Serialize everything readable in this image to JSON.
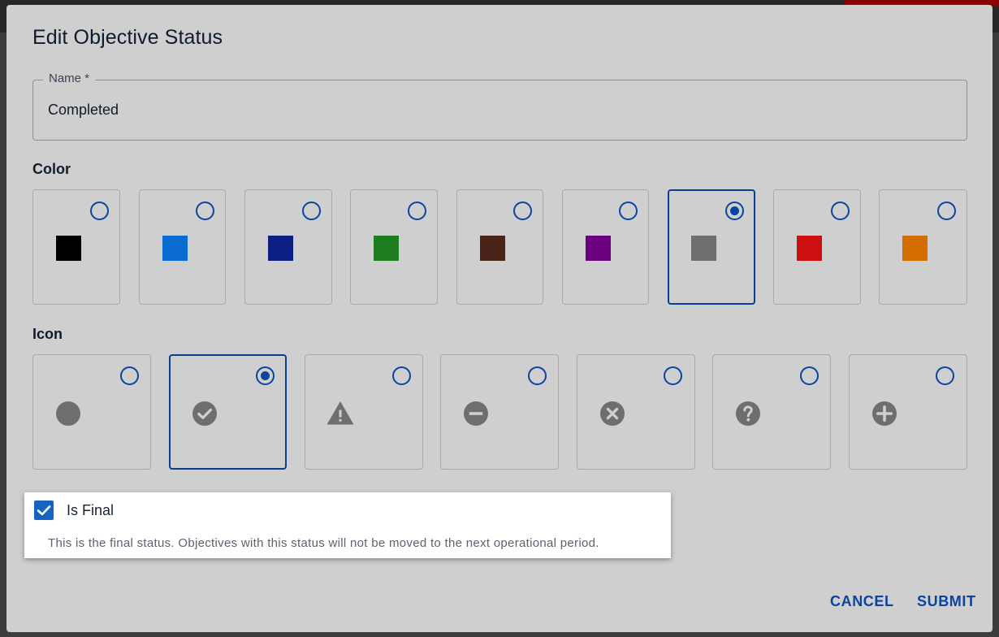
{
  "dialog": {
    "title": "Edit Objective Status"
  },
  "name_field": {
    "label": "Name *",
    "value": "Completed"
  },
  "color_section": {
    "label": "Color",
    "options": [
      {
        "color": "#000000",
        "selected": false
      },
      {
        "color": "#0a6bd1",
        "selected": false
      },
      {
        "color": "#0d1f85",
        "selected": false
      },
      {
        "color": "#1e7d1e",
        "selected": false
      },
      {
        "color": "#4a2418",
        "selected": false
      },
      {
        "color": "#6b0080",
        "selected": false
      },
      {
        "color": "#6e6e6e",
        "selected": true
      },
      {
        "color": "#cc0f0f",
        "selected": false
      },
      {
        "color": "#d46d00",
        "selected": false
      }
    ]
  },
  "icon_section": {
    "label": "Icon",
    "options": [
      {
        "icon": "circle-icon",
        "selected": false
      },
      {
        "icon": "check-circle-icon",
        "selected": true
      },
      {
        "icon": "warning-icon",
        "selected": false
      },
      {
        "icon": "minus-circle-icon",
        "selected": false
      },
      {
        "icon": "x-circle-icon",
        "selected": false
      },
      {
        "icon": "help-circle-icon",
        "selected": false
      },
      {
        "icon": "plus-circle-icon",
        "selected": false
      }
    ]
  },
  "is_final": {
    "label": "Is Final",
    "checked": true,
    "help_text": "This is the final status. Objectives with this status will not be moved to the next operational period."
  },
  "actions": {
    "cancel_label": "CANCEL",
    "submit_label": "SUBMIT"
  },
  "colors": {
    "accent": "#0b43a0",
    "icon_gray": "#6e6e6e",
    "checkbox": "#1565c0"
  }
}
